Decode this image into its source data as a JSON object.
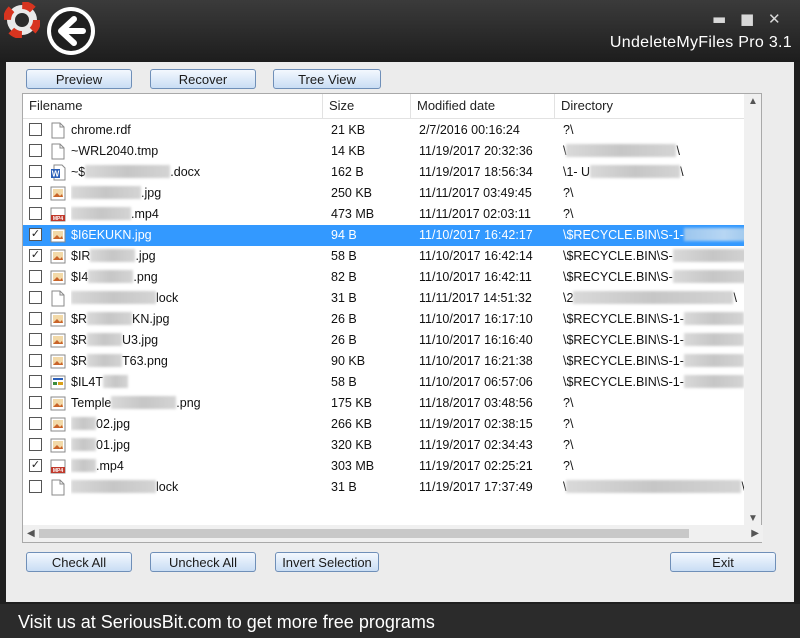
{
  "app": {
    "title": "UndeleteMyFiles Pro 3.1"
  },
  "window_controls": {
    "minimize": "▬",
    "maximize": "■",
    "close": "✕"
  },
  "toolbar": {
    "preview_label": "Preview",
    "recover_label": "Recover",
    "treeview_label": "Tree View"
  },
  "columns": {
    "filename": "Filename",
    "size": "Size",
    "modified": "Modified date",
    "directory": "Directory"
  },
  "rows": [
    {
      "checked": false,
      "selected": false,
      "icon": "generic-file-icon",
      "pre": "chrome.rdf",
      "blur": 0,
      "post": "",
      "size": "21 KB",
      "date": "2/7/2016 00:16:24",
      "dir_pre": "?\\",
      "dir_blur": 0,
      "dir_post": ""
    },
    {
      "checked": false,
      "selected": false,
      "icon": "generic-file-icon",
      "pre": "~WRL2040.tmp",
      "blur": 0,
      "post": "",
      "size": "14 KB",
      "date": "11/19/2017 20:32:36",
      "dir_pre": "\\",
      "dir_blur": 110,
      "dir_post": "\\"
    },
    {
      "checked": false,
      "selected": false,
      "icon": "word-doc-icon",
      "pre": "~$",
      "blur": 85,
      "post": ".docx",
      "size": "162 B",
      "date": "11/19/2017 18:56:34",
      "dir_pre": "\\1- U",
      "dir_blur": 90,
      "dir_post": "\\"
    },
    {
      "checked": false,
      "selected": false,
      "icon": "image-file-icon",
      "pre": "",
      "blur": 70,
      "post": ".jpg",
      "size": "250 KB",
      "date": "11/11/2017 03:49:45",
      "dir_pre": "?\\",
      "dir_blur": 0,
      "dir_post": ""
    },
    {
      "checked": false,
      "selected": false,
      "icon": "mp4-file-icon",
      "pre": "",
      "blur": 60,
      "post": ".mp4",
      "size": "473 MB",
      "date": "11/11/2017 02:03:11",
      "dir_pre": "?\\",
      "dir_blur": 0,
      "dir_post": ""
    },
    {
      "checked": true,
      "selected": true,
      "icon": "image-file-icon",
      "pre": "$I6EKUKN.jpg",
      "blur": 0,
      "post": "",
      "size": "94 B",
      "date": "11/10/2017 16:42:17",
      "dir_pre": "\\$RECYCLE.BIN\\S-1-",
      "dir_blur": 80,
      "dir_post": ""
    },
    {
      "checked": true,
      "selected": false,
      "icon": "image-file-icon",
      "pre": "$IR",
      "blur": 45,
      "post": ".jpg",
      "size": "58 B",
      "date": "11/10/2017 16:42:14",
      "dir_pre": "\\$RECYCLE.BIN\\S-",
      "dir_blur": 80,
      "dir_post": "80"
    },
    {
      "checked": false,
      "selected": false,
      "icon": "image-file-icon",
      "pre": "$I4",
      "blur": 45,
      "post": ".png",
      "size": "82 B",
      "date": "11/10/2017 16:42:11",
      "dir_pre": "\\$RECYCLE.BIN\\S-",
      "dir_blur": 80,
      "dir_post": "80"
    },
    {
      "checked": false,
      "selected": false,
      "icon": "generic-file-icon",
      "pre": "",
      "blur": 85,
      "post": "lock",
      "size": "31 B",
      "date": "11/11/2017 14:51:32",
      "dir_pre": "\\2",
      "dir_blur": 160,
      "dir_post": "\\"
    },
    {
      "checked": false,
      "selected": false,
      "icon": "image-file-icon",
      "pre": "$R",
      "blur": 45,
      "post": "KN.jpg",
      "size": "26 B",
      "date": "11/10/2017 16:17:10",
      "dir_pre": "\\$RECYCLE.BIN\\S-1-",
      "dir_blur": 60,
      "dir_post": "80"
    },
    {
      "checked": false,
      "selected": false,
      "icon": "image-file-icon",
      "pre": "$R",
      "blur": 35,
      "post": "U3.jpg",
      "size": "26 B",
      "date": "11/10/2017 16:16:40",
      "dir_pre": "\\$RECYCLE.BIN\\S-1-",
      "dir_blur": 60,
      "dir_post": "80"
    },
    {
      "checked": false,
      "selected": false,
      "icon": "image-file-icon",
      "pre": "$R",
      "blur": 35,
      "post": "T63.png",
      "size": "90 KB",
      "date": "11/10/2017 16:21:38",
      "dir_pre": "\\$RECYCLE.BIN\\S-1-",
      "dir_blur": 60,
      "dir_post": "80"
    },
    {
      "checked": false,
      "selected": false,
      "icon": "exe-file-icon",
      "pre": "$IL4T",
      "blur": 25,
      "post": "",
      "size": "58 B",
      "date": "11/10/2017 06:57:06",
      "dir_pre": "\\$RECYCLE.BIN\\S-1-",
      "dir_blur": 60,
      "dir_post": "80"
    },
    {
      "checked": false,
      "selected": false,
      "icon": "image-file-icon",
      "pre": "Temple",
      "blur": 65,
      "post": ".png",
      "size": "175 KB",
      "date": "11/18/2017 03:48:56",
      "dir_pre": "?\\",
      "dir_blur": 0,
      "dir_post": ""
    },
    {
      "checked": false,
      "selected": false,
      "icon": "image-file-icon",
      "pre": "",
      "blur": 25,
      "post": "02.jpg",
      "size": "266 KB",
      "date": "11/19/2017 02:38:15",
      "dir_pre": "?\\",
      "dir_blur": 0,
      "dir_post": ""
    },
    {
      "checked": false,
      "selected": false,
      "icon": "image-file-icon",
      "pre": "",
      "blur": 25,
      "post": "01.jpg",
      "size": "320 KB",
      "date": "11/19/2017 02:34:43",
      "dir_pre": "?\\",
      "dir_blur": 0,
      "dir_post": ""
    },
    {
      "checked": true,
      "selected": false,
      "icon": "mp4-file-icon",
      "pre": "",
      "blur": 25,
      "post": ".mp4",
      "size": "303 MB",
      "date": "11/19/2017 02:25:21",
      "dir_pre": "?\\",
      "dir_blur": 0,
      "dir_post": ""
    },
    {
      "checked": false,
      "selected": false,
      "icon": "generic-file-icon",
      "pre": "",
      "blur": 85,
      "post": "lock",
      "size": "31 B",
      "date": "11/19/2017 17:37:49",
      "dir_pre": "\\",
      "dir_blur": 175,
      "dir_post": "\\"
    }
  ],
  "bottom": {
    "check_all_label": "Check All",
    "uncheck_all_label": "Uncheck All",
    "invert_label": "Invert Selection",
    "exit_label": "Exit"
  },
  "status": {
    "text": "Visit us at SeriousBit.com to get more free programs"
  },
  "colors": {
    "selection": "#3399ff",
    "button_border": "#6f8fb8"
  }
}
